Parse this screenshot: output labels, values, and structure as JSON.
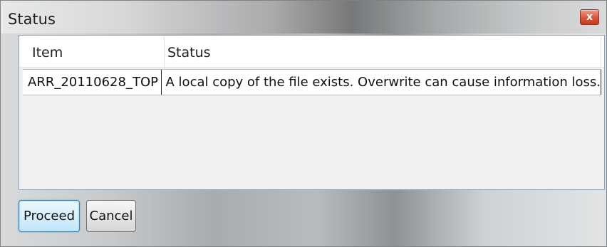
{
  "window": {
    "title": "Status",
    "close_symbol": "x",
    "close_icon": "close-icon"
  },
  "table": {
    "columns": [
      "Item",
      "Status"
    ],
    "rows": [
      {
        "item": "ARR_20110628_TOP",
        "status": "A local copy of the file exists. Overwrite can cause information loss."
      }
    ]
  },
  "buttons": {
    "proceed_label": "Proceed",
    "cancel_label": "Cancel"
  },
  "colors": {
    "close_button": "#d9553a",
    "focused_button_border": "#3c7fb1",
    "list_border": "#8d9eb2"
  }
}
